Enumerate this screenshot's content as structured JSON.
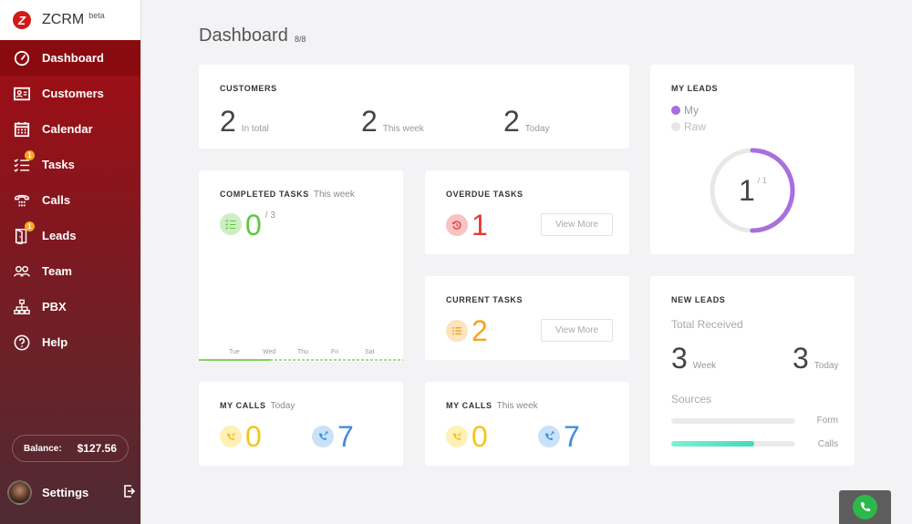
{
  "app": {
    "name": "ZCRM",
    "tag": "beta"
  },
  "sidebar": {
    "items": [
      {
        "label": "Dashboard",
        "icon": "speedometer-icon",
        "active": true
      },
      {
        "label": "Customers",
        "icon": "contact-card-icon"
      },
      {
        "label": "Calendar",
        "icon": "calendar-icon"
      },
      {
        "label": "Tasks",
        "icon": "checklist-icon",
        "badge": "1"
      },
      {
        "label": "Calls",
        "icon": "telephone-icon"
      },
      {
        "label": "Leads",
        "icon": "door-icon",
        "badge": "1"
      },
      {
        "label": "Team",
        "icon": "team-icon"
      },
      {
        "label": "PBX",
        "icon": "network-icon"
      },
      {
        "label": "Help",
        "icon": "help-icon"
      }
    ],
    "balance": {
      "label": "Balance:",
      "value": "$127.56"
    },
    "settings_label": "Settings"
  },
  "header": {
    "title": "Dashboard",
    "count": "8/8"
  },
  "customers": {
    "title": "CUSTOMERS",
    "stats": [
      {
        "value": "2",
        "label": "In total"
      },
      {
        "value": "2",
        "label": "This week"
      },
      {
        "value": "2",
        "label": "Today"
      }
    ]
  },
  "completed_tasks": {
    "title": "COMPLETED TASKS",
    "subtitle": "This week",
    "value": "0",
    "total": "/ 3",
    "days": [
      "Tue",
      "Wed",
      "Thu",
      "Fri",
      "Sat"
    ]
  },
  "overdue_tasks": {
    "title": "OVERDUE TASKS",
    "value": "1",
    "button": "View More"
  },
  "current_tasks": {
    "title": "CURRENT TASKS",
    "value": "2",
    "button": "View More"
  },
  "my_calls_today": {
    "title": "MY CALLS",
    "subtitle": "Today",
    "incoming": "0",
    "outgoing": "7"
  },
  "my_calls_week": {
    "title": "MY CALLS",
    "subtitle": "This week",
    "incoming": "0",
    "outgoing": "7"
  },
  "my_leads": {
    "title": "MY LEADS",
    "legend": [
      {
        "label": "My",
        "color": "#a86fe0"
      },
      {
        "label": "Raw",
        "color": "#e6e6e6"
      }
    ],
    "value": "1",
    "total": "/ 1",
    "fraction": 0.5
  },
  "new_leads": {
    "title": "NEW LEADS",
    "total_label": "Total Received",
    "week_value": "3",
    "week_label": "Week",
    "today_value": "3",
    "today_label": "Today",
    "sources_label": "Sources",
    "sources": [
      {
        "label": "Form",
        "fraction": 0.0
      },
      {
        "label": "Calls",
        "fraction": 0.67
      }
    ]
  },
  "colors": {
    "accent": "#9c0f14",
    "green": "#5cc83b",
    "red": "#e53935",
    "orange": "#f5a623",
    "yellow": "#f5c518",
    "blue": "#3d8fe0",
    "purple": "#a86fe0"
  }
}
